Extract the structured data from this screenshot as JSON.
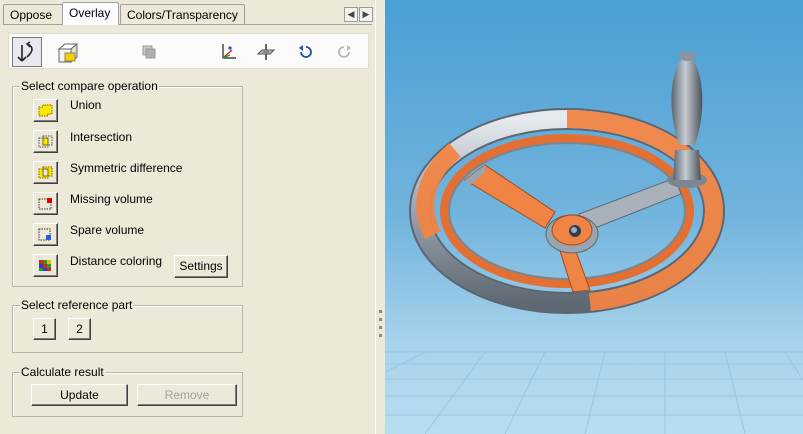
{
  "tabs": [
    {
      "label": "Oppose"
    },
    {
      "label": "Overlay"
    },
    {
      "label": "Colors/Transparency"
    }
  ],
  "tab_nav": {
    "prev": "◀",
    "next": "▶"
  },
  "toolbar": {
    "icons": [
      "rotate-view-icon",
      "box-view-icon",
      "overlap-icon",
      "axis-icon",
      "plane-icon",
      "undo-icon",
      "redo-icon"
    ]
  },
  "compare": {
    "title": "Select compare operation",
    "operations": [
      {
        "label": "Union"
      },
      {
        "label": "Intersection"
      },
      {
        "label": "Symmetric difference"
      },
      {
        "label": "Missing volume"
      },
      {
        "label": "Spare volume"
      },
      {
        "label": "Distance coloring"
      }
    ],
    "settings_label": "Settings"
  },
  "reference": {
    "title": "Select reference part",
    "buttons": [
      {
        "label": "1"
      },
      {
        "label": "2"
      }
    ]
  },
  "result": {
    "title": "Calculate result",
    "update_label": "Update",
    "remove_label": "Remove"
  },
  "colors": {
    "panel_bg": "#ece9d8",
    "viewport_top": "#4a9fd4",
    "viewport_bottom": "#b9ddf0",
    "metal": "#a9b2bb",
    "highlight": "#ee7a3a"
  }
}
